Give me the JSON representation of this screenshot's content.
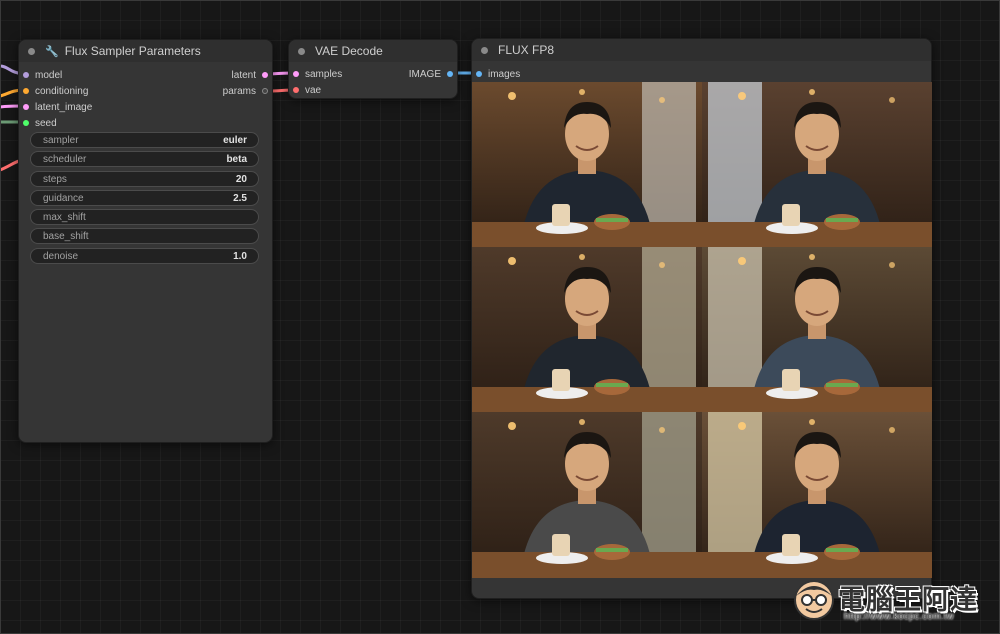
{
  "colors": {
    "model": "#b39ddb",
    "conditioning": "#ffa931",
    "latent": "#ff9cf9",
    "noise": "#b0b0b0",
    "seed": "#4fff6a",
    "params": "#444444",
    "vae": "#ff6e6e",
    "image": "#64b5f6"
  },
  "sampler_node": {
    "title": "Flux Sampler Parameters",
    "title_icon": "wrench-icon",
    "inputs": [
      "model",
      "conditioning",
      "latent_image",
      "seed"
    ],
    "outputs": [
      "latent",
      "params"
    ],
    "widgets": [
      {
        "label": "sampler",
        "value": "euler"
      },
      {
        "label": "scheduler",
        "value": "beta"
      },
      {
        "label": "steps",
        "value": "20"
      },
      {
        "label": "guidance",
        "value": "2.5"
      },
      {
        "label": "max_shift",
        "value": ""
      },
      {
        "label": "base_shift",
        "value": ""
      },
      {
        "label": "denoise",
        "value": "1.0"
      }
    ]
  },
  "vae_node": {
    "title": "VAE Decode",
    "inputs": [
      "samples",
      "vae"
    ],
    "outputs": [
      "IMAGE"
    ]
  },
  "preview_node": {
    "title": "FLUX FP8",
    "inputs": [
      "images"
    ],
    "image_count": 6
  },
  "watermark": {
    "brand": "電腦王阿達",
    "url": "http://www.kocpc.com.tw"
  }
}
